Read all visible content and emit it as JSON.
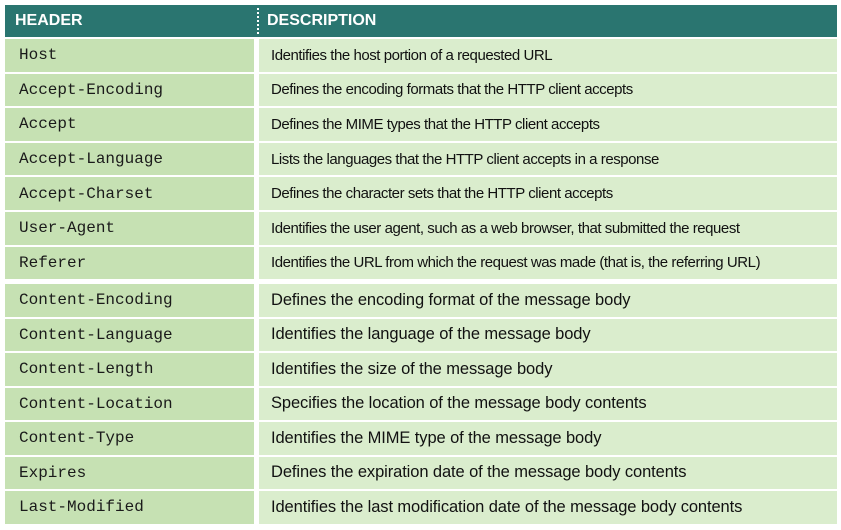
{
  "table": {
    "header": {
      "col1": "HEADER",
      "col2": "DESCRIPTION"
    },
    "request_rows": [
      {
        "name": "Host",
        "description": "Identifies the host portion of a requested URL"
      },
      {
        "name": "Accept-Encoding",
        "description": "Defines the encoding formats that the HTTP client accepts"
      },
      {
        "name": "Accept",
        "description": "Defines the MIME types that the HTTP client accepts"
      },
      {
        "name": "Accept-Language",
        "description": "Lists the languages that the HTTP client accepts in a response"
      },
      {
        "name": "Accept-Charset",
        "description": "Defines the character sets that the HTTP client accepts"
      },
      {
        "name": "User-Agent",
        "description": "Identifies the user agent, such as a web browser, that submitted the request"
      },
      {
        "name": "Referer",
        "description": "Identifies the URL from which the request was made (that is, the referring URL)"
      }
    ],
    "entity_rows": [
      {
        "name": "Content-Encoding",
        "description": "Defines the encoding format of the message body"
      },
      {
        "name": "Content-Language",
        "description": "Identifies the language of the message body"
      },
      {
        "name": "Content-Length",
        "description": "Identifies the size of the message body"
      },
      {
        "name": "Content-Location",
        "description": "Specifies the location of the message body contents"
      },
      {
        "name": "Content-Type",
        "description": "Identifies the MIME type of the message body"
      },
      {
        "name": "Expires",
        "description": "Defines the expiration date of the message body contents"
      },
      {
        "name": "Last-Modified",
        "description": "Identifies the last modification date of the message body contents"
      }
    ],
    "colors": {
      "header_bg": "#2a7570",
      "name_bg": "#c6e1b3",
      "desc_bg": "#daedcd"
    }
  }
}
